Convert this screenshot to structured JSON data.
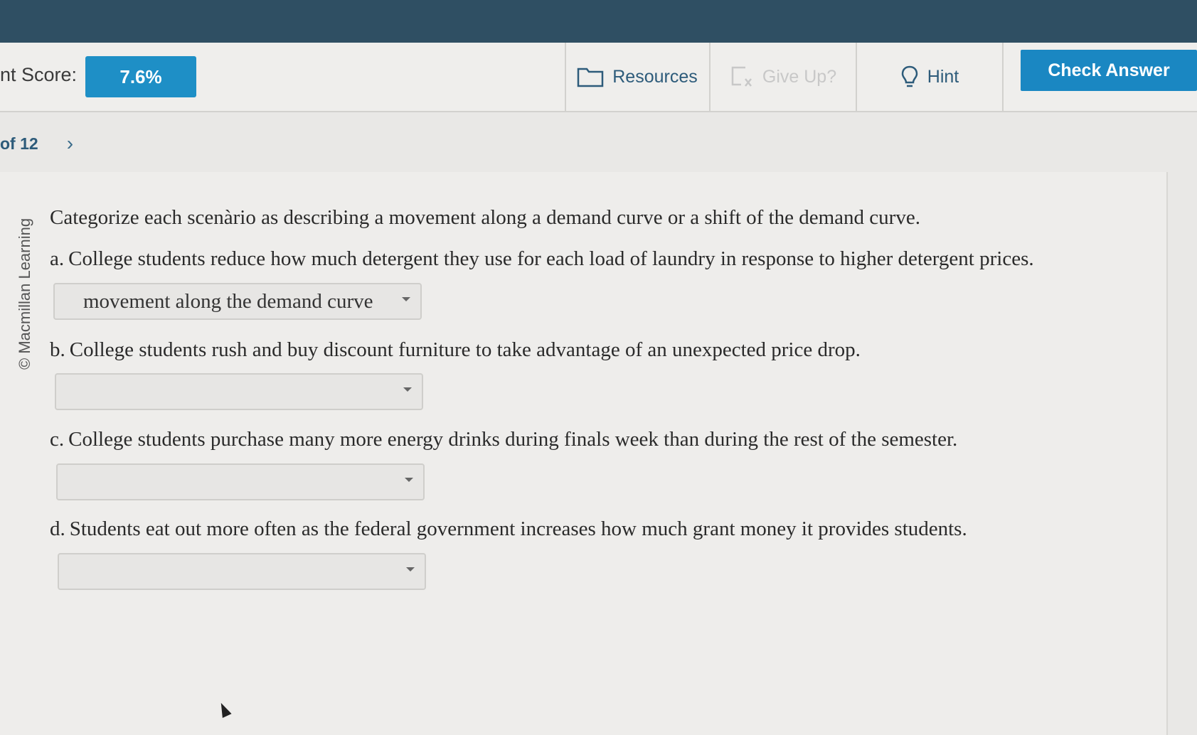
{
  "toolbar": {
    "score_label": "nt Score:",
    "score_value": "7.6%",
    "resources_label": "Resources",
    "give_up_label": "Give Up?",
    "hint_label": "Hint",
    "check_answer_label": "Check Answer"
  },
  "pager": {
    "text": "of 12"
  },
  "copyright": "© Macmillan Learning",
  "intro": "Categorize each scenàrio as describing a movement along a demand curve or a shift of the demand curve.",
  "questions": [
    {
      "letter": "a.",
      "text": "College students reduce how much detergent they use for each load of laundry in response to higher detergent prices.",
      "selected": "movement along the demand curve"
    },
    {
      "letter": "b.",
      "text": "College students rush and buy discount furniture to take advantage of an unexpected price drop.",
      "selected": ""
    },
    {
      "letter": "c.",
      "text": "College students purchase many more energy drinks during finals week than during the rest of the semester.",
      "selected": ""
    },
    {
      "letter": "d.",
      "text": "Students eat out more often as the federal government increases how much grant money it provides students.",
      "selected": ""
    }
  ],
  "colors": {
    "accent": "#1a87c2",
    "score_box": "#1e8fc6",
    "header_band": "#2f4f63",
    "link_text": "#2d5b7a"
  }
}
